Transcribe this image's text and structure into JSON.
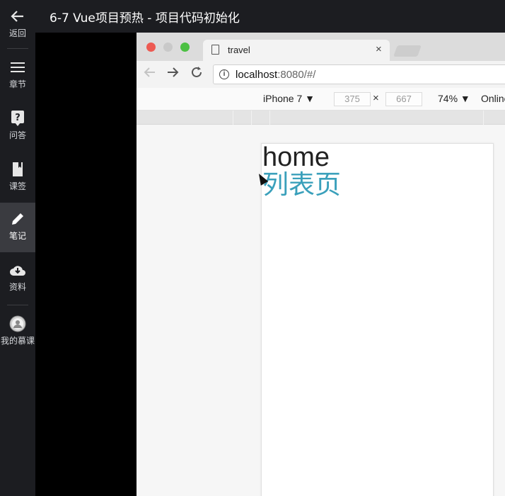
{
  "header": {
    "title": "6-7 Vue项目预热 - 项目代码初始化"
  },
  "sidebar": {
    "items": [
      {
        "icon": "back-arrow-icon",
        "label": "返回"
      },
      {
        "icon": "menu-icon",
        "label": "章节"
      },
      {
        "icon": "question-icon",
        "label": "问答"
      },
      {
        "icon": "bookmark-icon",
        "label": "课签"
      },
      {
        "icon": "pencil-icon",
        "label": "笔记",
        "active": true
      },
      {
        "icon": "cloud-download-icon",
        "label": "资料"
      },
      {
        "icon": "avatar-icon",
        "label": "我的慕课"
      }
    ]
  },
  "browser": {
    "tab_title": "travel",
    "tab_close": "×",
    "url_host": "localhost",
    "url_path": ":8080/#/",
    "device": "iPhone 7 ▼",
    "width": "375",
    "times": "×",
    "height": "667",
    "zoom": "74% ▼",
    "throttle": "Online"
  },
  "page": {
    "home_text": "home",
    "list_text": "列表页"
  },
  "colors": {
    "sidebar_bg": "#1c1d21",
    "active_bg": "#3a3b40",
    "link_teal": "#3aa0bb"
  }
}
